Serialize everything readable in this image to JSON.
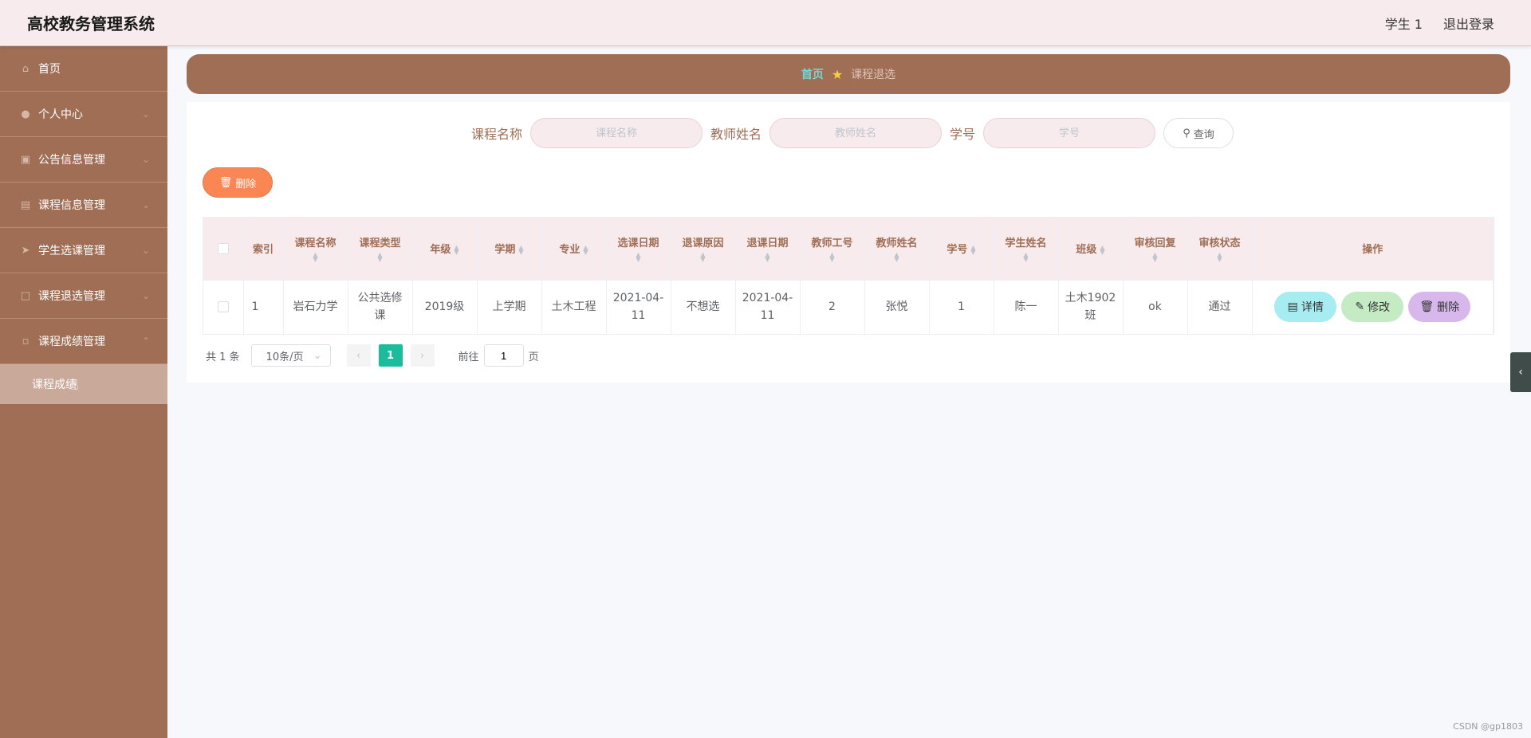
{
  "header": {
    "title": "高校教务管理系统",
    "user": "学生 1",
    "logout": "退出登录"
  },
  "sidebar": {
    "items": [
      {
        "label": "首页",
        "icon": "home-icon"
      },
      {
        "label": "个人中心",
        "icon": "user-icon"
      },
      {
        "label": "公告信息管理",
        "icon": "id-card-icon"
      },
      {
        "label": "课程信息管理",
        "icon": "clipboard-icon"
      },
      {
        "label": "学生选课管理",
        "icon": "send-icon"
      },
      {
        "label": "课程退选管理",
        "icon": "scan-icon"
      },
      {
        "label": "课程成绩管理",
        "icon": "message-icon"
      }
    ],
    "submenu": {
      "label": "课程成绩"
    }
  },
  "breadcrumb": {
    "home": "首页",
    "current": "课程退选"
  },
  "search": {
    "course_label": "课程名称",
    "course_placeholder": "课程名称",
    "teacher_label": "教师姓名",
    "teacher_placeholder": "教师姓名",
    "student_label": "学号",
    "student_placeholder": "学号",
    "query_button": "查询"
  },
  "actions": {
    "delete_button": "删除"
  },
  "table": {
    "headers": [
      "索引",
      "课程名称",
      "课程类型",
      "年级",
      "学期",
      "专业",
      "选课日期",
      "退课原因",
      "退课日期",
      "教师工号",
      "教师姓名",
      "学号",
      "学生姓名",
      "班级",
      "审核回复",
      "审核状态",
      "操作"
    ],
    "rows": [
      {
        "index": "1",
        "course_name": "岩石力学",
        "course_type": "公共选修课",
        "grade": "2019级",
        "term": "上学期",
        "major": "土木工程",
        "select_date": "2021-04-11",
        "drop_reason": "不想选",
        "drop_date": "2021-04-11",
        "teacher_id": "2",
        "teacher_name": "张悦",
        "student_id": "1",
        "student_name": "陈一",
        "class": "土木1902班",
        "review_reply": "ok",
        "review_status": "通过"
      }
    ],
    "ops": {
      "detail": "详情",
      "edit": "修改",
      "delete": "删除"
    }
  },
  "pagination": {
    "total": "共 1 条",
    "page_size": "10条/页",
    "current_page": "1",
    "goto_label": "前往",
    "goto_value": "1",
    "page_unit": "页"
  },
  "watermark": "CSDN @gp1803"
}
